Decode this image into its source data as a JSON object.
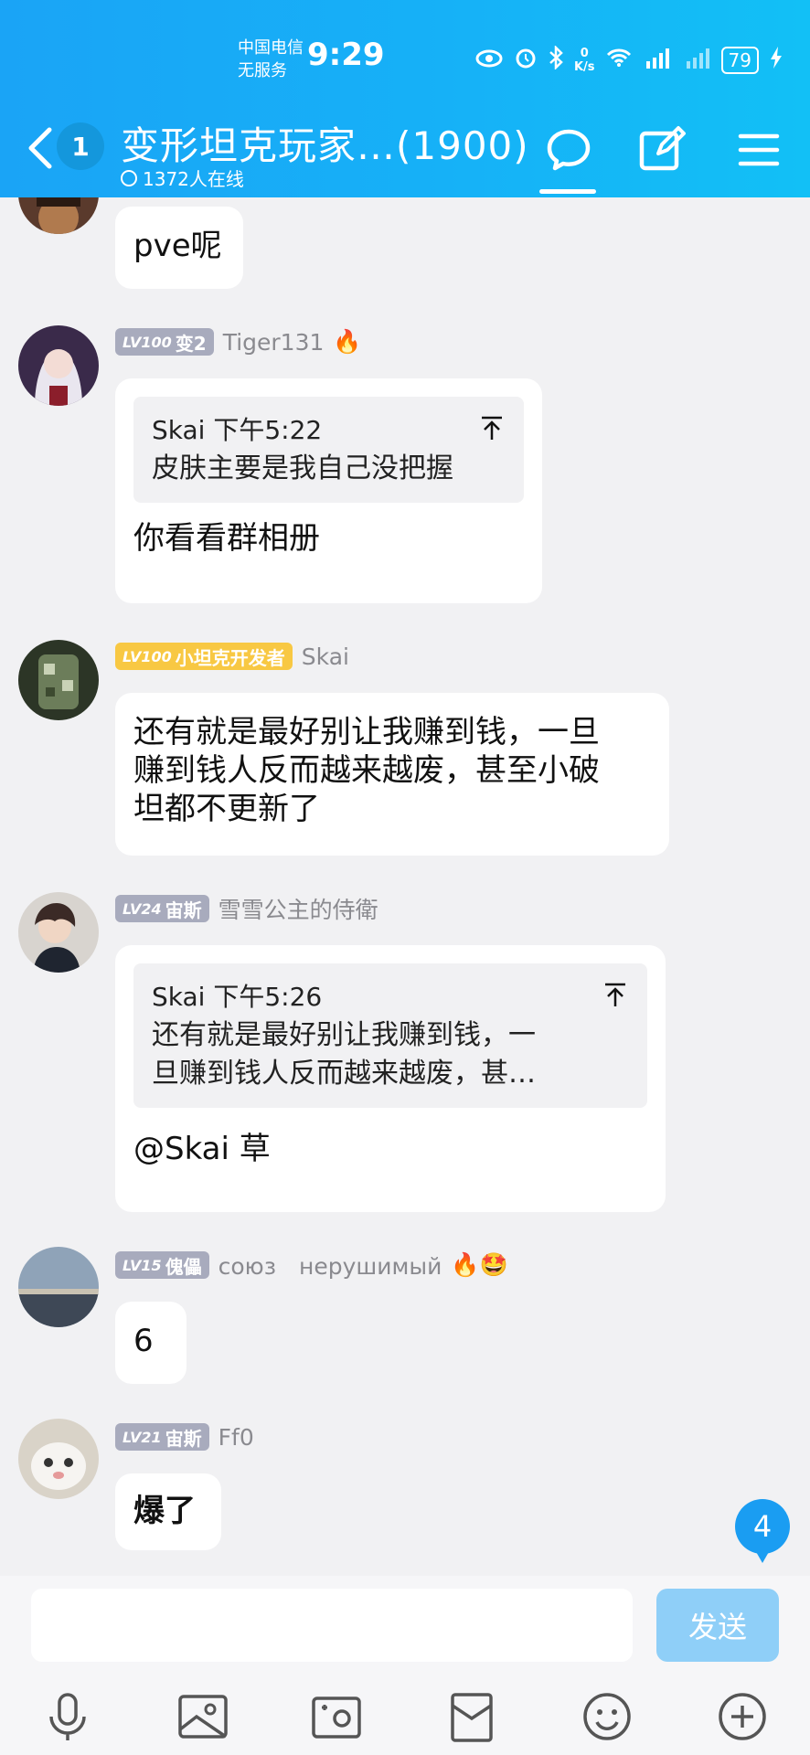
{
  "status_bar": {
    "carrier_line1": "中国电信",
    "carrier_line2": "无服务",
    "time": "9:29",
    "net_speed_value": "0",
    "net_speed_unit": "K/s",
    "battery": "79"
  },
  "header": {
    "unread_count": "1",
    "title": "变形坦克玩家…(1900)",
    "online": "1372人在线"
  },
  "messages": [
    {
      "text": "pve呢"
    },
    {
      "level": "LV100",
      "title_tag": "变2",
      "sender": "Tiger131",
      "emoji": "🔥",
      "quote_header": "Skai 下午5:22",
      "quote_text": "皮肤主要是我自己没把握",
      "text": "你看看群相册"
    },
    {
      "level": "LV100",
      "title_tag": "小坦克开发者",
      "sender": "Skai",
      "text_lines": [
        "还有就是最好别让我赚到钱，一旦",
        "赚到钱人反而越来越废，甚至小破",
        "坦都不更新了"
      ]
    },
    {
      "level": "LV24",
      "title_tag": "宙斯",
      "sender": "雪雪公主的侍衛",
      "quote_header": "Skai 下午5:26",
      "quote_lines": [
        "还有就是最好别让我赚到钱，一",
        "旦赚到钱人反而越来越废，甚…"
      ],
      "text": "@Skai 草"
    },
    {
      "level": "LV15",
      "title_tag": "傀儡",
      "sender": "союз　нерушимый",
      "emoji": "🔥🤩",
      "text": "6"
    },
    {
      "level": "LV21",
      "title_tag": "宙斯",
      "sender": "Ff0",
      "text": "爆了"
    }
  ],
  "new_message_count": "4",
  "input": {
    "placeholder": "",
    "send_label": "发送"
  },
  "toolbar_icons": [
    "microphone-icon",
    "image-icon",
    "camera-icon",
    "red-packet-icon",
    "emoji-icon",
    "plus-icon"
  ],
  "colors": {
    "header": "#1aa4f6",
    "badge": "#1a9df2",
    "send_disabled": "#8fcff8",
    "level_gold": "#f8c843",
    "level_gray": "#a8abbd"
  }
}
